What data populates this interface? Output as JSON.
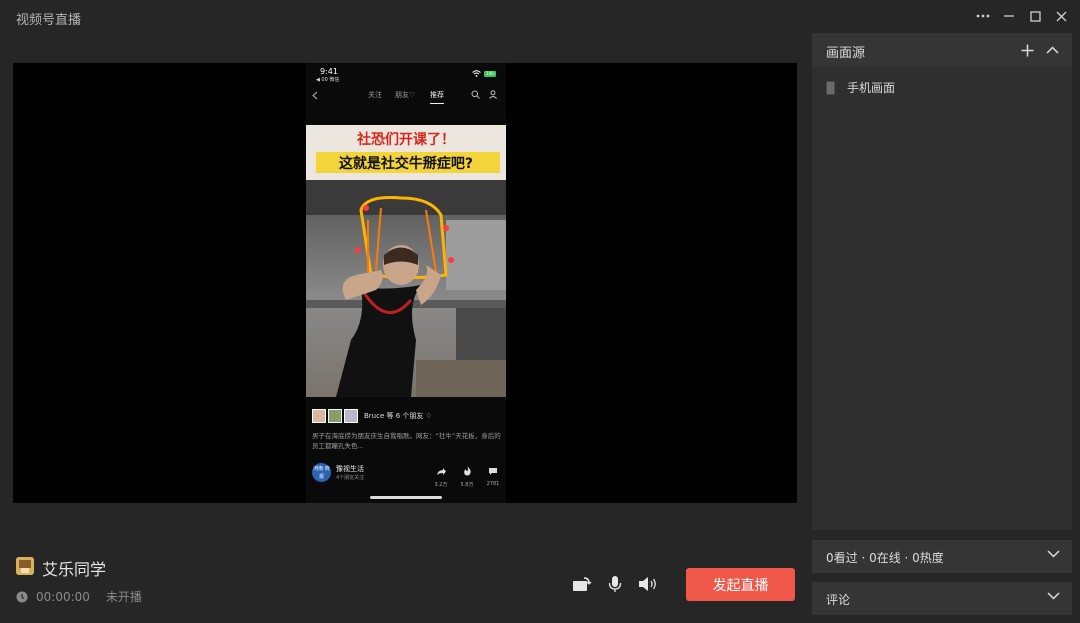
{
  "window": {
    "title": "视频号直播"
  },
  "phone": {
    "time": "9:41",
    "carrier": "◀ 00 微信",
    "battery": "100",
    "tabs": [
      {
        "label": "关注",
        "active": false
      },
      {
        "label": "朋友♡",
        "active": false
      },
      {
        "label": "推荐",
        "active": true
      }
    ],
    "video": {
      "headline_line1": "社恐们开课了！",
      "headline_line2": "这就是社交牛掰症吧?"
    },
    "friends_text": "Bruce 等 6 个朋友 ♢",
    "description": "男子在海底捞为朋友庆生自我唱歌。网友：“社牛”天花板，身后的员工都瞳孔失色...",
    "account": {
      "logo_text": "河南 商报",
      "name": "豫视生活",
      "sub": "4个朋友关注"
    },
    "actions": [
      {
        "icon": "share-icon",
        "count": "3.2万"
      },
      {
        "icon": "fire-icon",
        "count": "5.8万"
      },
      {
        "icon": "comment-icon",
        "count": "2781"
      }
    ]
  },
  "streamer": {
    "name": "艾乐同学"
  },
  "timer": {
    "time": "00:00:00",
    "status": "未开播"
  },
  "controls": {
    "start_label": "发起直播"
  },
  "sources_panel": {
    "title": "画面源",
    "items": [
      {
        "label": "手机画面"
      }
    ]
  },
  "stats": {
    "text": "0看过 · 0在线 · 0热度"
  },
  "comments": {
    "title": "评论"
  },
  "colors": {
    "accent": "#f0584a",
    "background": "#262626",
    "panel": "#2f2f2f"
  }
}
